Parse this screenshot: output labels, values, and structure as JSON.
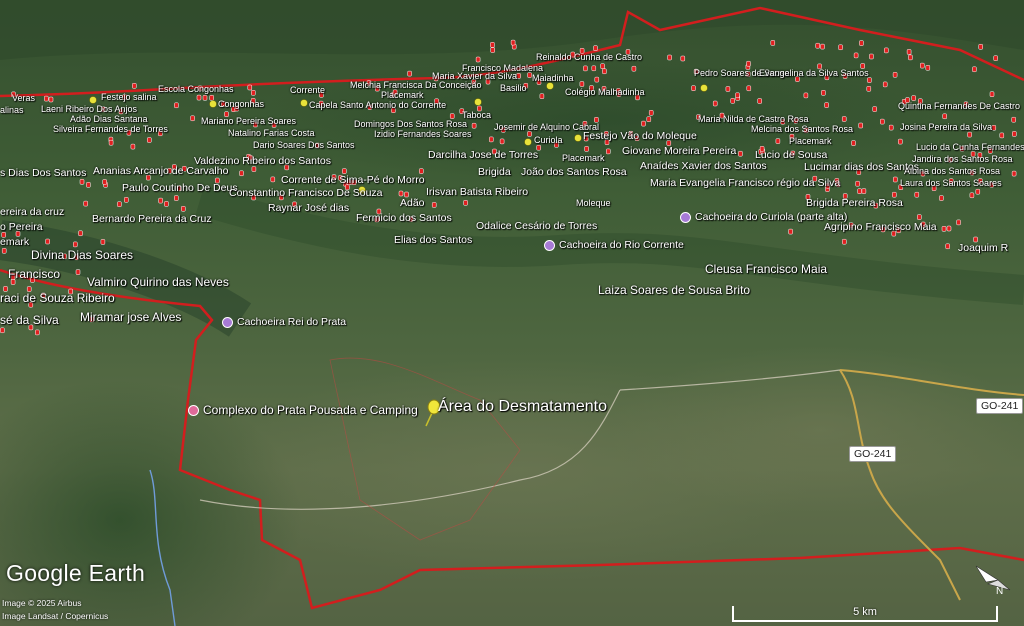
{
  "colors": {
    "boundary": "#d21e1e",
    "pin": "#e8e23a",
    "marker": "#e02020",
    "poi": "#a77bd6",
    "road": "#c9a64a"
  },
  "main_label": "Área do Desmatamento",
  "top_labels": [
    "Festejo salina",
    "Escola Congonhas",
    "Laeni Ribeiro Dos Anjos",
    "Adão Dias Santana",
    "Silveira Fernandes de Torres",
    "Congonhas",
    "Mariano Pereira Soares",
    "Natalino Farias Costa",
    "Dario Soares Dos Santos",
    "Corrente",
    "Capela Santo Antonio do Corrente",
    "Placemark",
    "Domingos Dos Santos Rosa",
    "Izidio Fernandes Soares",
    "Melchia Francisca Da Conceição",
    "Taboca",
    "Francisco Madalena",
    "Maria Xavier da Silva",
    "Basilio",
    "Reinaldo Cunha de Castro",
    "Maiadinha",
    "Colégio Malhadinha",
    "Josemir de Alquino Cabral",
    "Curiola",
    "Darcilha Jose de Torres",
    "Brigida",
    "João dos Santos Rosa",
    "Festejo Vão do Moleque",
    "Placemark",
    "Giovane Moreira Pereira",
    "Anaídes Xavier dos Santos",
    "Pedro Soares de Sousa",
    "Evangelina da Silva Santos",
    "Lucio de Sousa",
    "Maria Nilda de Castro Rosa",
    "Melcina dos Santos Rosa",
    "Placemark",
    "Lucimar dias dos Santos",
    "Maria Evangelia Francisco régio da Silva",
    "Brigida Pereira Rosa",
    "Agripino Francisco Maia",
    "Joaquim R",
    "Quintina Fernandes De Castro",
    "Josina Pereira da Silva",
    "Lucio da Cunha Fernandes",
    "Jandira dos Santos Rosa",
    "Albina dos Santos Rosa",
    "Laura dos Santos Soares",
    "Valdezino Ribeiro dos Santos",
    "Ananias Arcanjo de Carvalho",
    "Paulo Coutinho De Deus",
    "Corrente de Sima-Pé do Morro",
    "Constantino Francisco De Souza",
    "Raynar José dias",
    "Irisvan Batista Ribeiro",
    "Adão",
    "Fermicio dos Santos",
    "Elias dos Santos",
    "Odalice Cesário de Torres",
    "Moleque",
    "Cleusa Francisco Maia",
    "Laiza Soares de Sousa Brito",
    "Divina Dias Soares",
    "Valmiro Quirino das Neves",
    "Francisco",
    "raci de Souza Ribeiro",
    "sé da Silva",
    "Miramar jose Alves",
    "Bernardo Pereira da Cruz",
    "ereira da cruz",
    "o Pereira",
    "emark",
    "s Dias Dos Santos",
    "alinas",
    "Veras"
  ],
  "pois": [
    "Cachoeira do Curiola (parte alta)",
    "Cachoeira do Rio Corrente",
    "Cachoeira Rei do Prata",
    "Complexo do Prata Pousada e Camping"
  ],
  "road_labels": [
    "GO-241",
    "GO-241"
  ],
  "branding": {
    "logo": "Google Earth",
    "credit1": "Image © 2025 Airbus",
    "credit2": "Image Landsat / Copernicus"
  },
  "scale_label": "5 km"
}
